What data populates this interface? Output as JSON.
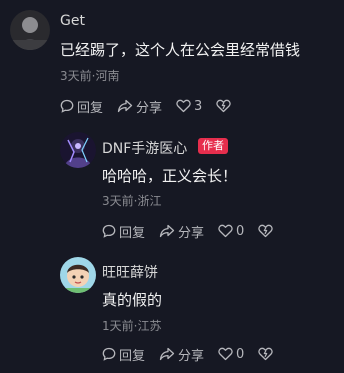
{
  "comments": [
    {
      "username": "Get",
      "content": "已经踢了，这个人在公会里经常借钱",
      "meta": "3天前·河南",
      "actions": {
        "reply": "回复",
        "share": "分享",
        "likes": "3"
      }
    },
    {
      "username": "DNF手游医心",
      "badge": "作者",
      "content": "哈哈哈，正义会长！",
      "meta": "3天前·浙江",
      "actions": {
        "reply": "回复",
        "share": "分享",
        "likes": "0"
      }
    },
    {
      "username": "旺旺薛饼",
      "content": "真的假的",
      "meta": "1天前·江苏",
      "actions": {
        "reply": "回复",
        "share": "分享",
        "likes": "0"
      }
    }
  ],
  "colors": {
    "background": "#161823",
    "author_badge": "#e62e4d",
    "meta_text": "#8a8b91"
  },
  "icons": [
    "reply-icon",
    "share-icon",
    "heart-icon",
    "dislike-icon"
  ]
}
